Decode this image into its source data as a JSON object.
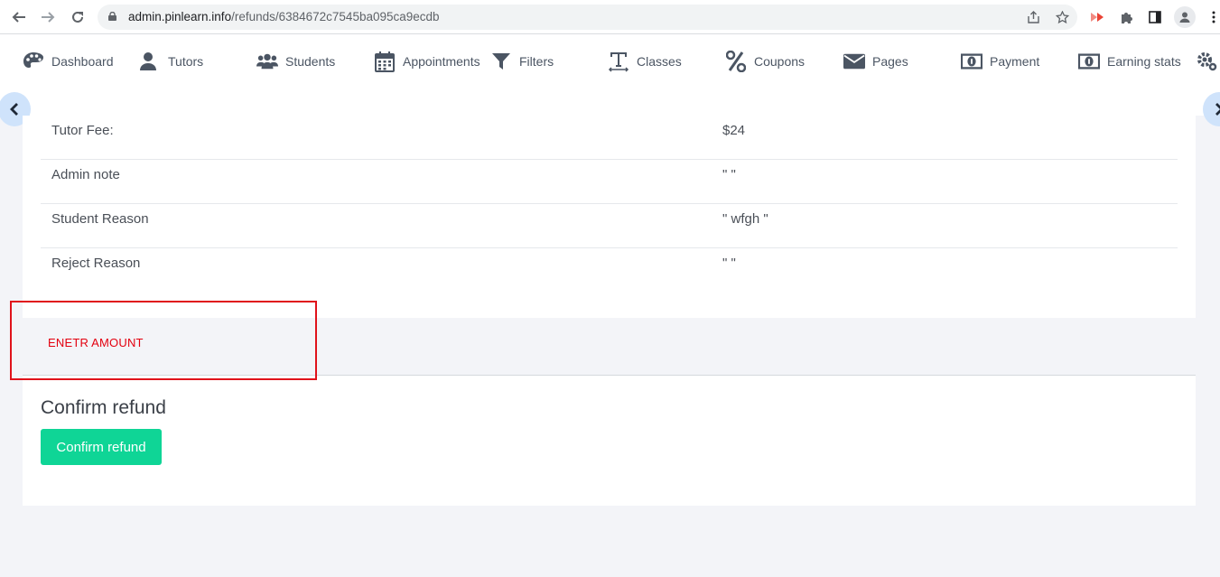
{
  "browser": {
    "url_host": "admin.pinlearn.info",
    "url_path": "/refunds/6384672c7545ba095ca9ecdb"
  },
  "nav": {
    "items": [
      {
        "label": "Dashboard",
        "icon": "palette-icon"
      },
      {
        "label": "Tutors",
        "icon": "user-icon"
      },
      {
        "label": "Students",
        "icon": "users-icon"
      },
      {
        "label": "Appointments",
        "icon": "calendar-icon"
      },
      {
        "label": "Filters",
        "icon": "filter-icon"
      },
      {
        "label": "Classes",
        "icon": "text-height-icon"
      },
      {
        "label": "Coupons",
        "icon": "percent-icon"
      },
      {
        "label": "Pages",
        "icon": "envelope-icon"
      },
      {
        "label": "Payment",
        "icon": "money-bill-icon"
      },
      {
        "label": "Earning stats",
        "icon": "money-bill-icon"
      }
    ]
  },
  "details": {
    "rows": [
      {
        "label": "Tutor Fee:",
        "value": "$24"
      },
      {
        "label": "Admin note",
        "value": "\" \""
      },
      {
        "label": "Student Reason",
        "value": "\" wfgh \""
      },
      {
        "label": "Reject Reason",
        "value": "\" \""
      }
    ]
  },
  "refund": {
    "amount_label": "ENETR AMOUNT",
    "confirm_title": "Confirm refund",
    "confirm_button": "Confirm refund"
  },
  "colors": {
    "accent_button": "#0fd596",
    "error_text": "#e3000f",
    "highlight_border": "#e0121b"
  }
}
